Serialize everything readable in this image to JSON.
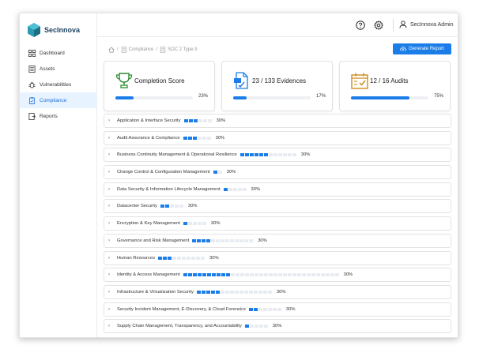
{
  "brand": {
    "name": "SecInnova",
    "color": "#2a9ab1"
  },
  "accent": "#1b7de8",
  "sidebar": {
    "items": [
      {
        "label": "Dashboard",
        "icon": "grid-icon",
        "active": false
      },
      {
        "label": "Assets",
        "icon": "list-icon",
        "active": false
      },
      {
        "label": "Vulnerabilities",
        "icon": "bug-icon",
        "active": false
      },
      {
        "label": "Compliance",
        "icon": "clipboard-icon",
        "active": true
      },
      {
        "label": "Reports",
        "icon": "report-icon",
        "active": false
      }
    ]
  },
  "topbar": {
    "user_name": "SecInnova Admin"
  },
  "breadcrumb": {
    "items": [
      "Compliance",
      "SOC 2 Type II"
    ]
  },
  "toolbar": {
    "generate_label": "Generate Report"
  },
  "cards": [
    {
      "title": "Completion Score",
      "percent_label": "23%",
      "progress": 0.23,
      "icon": "trophy-icon"
    },
    {
      "title": "23 / 133 Evidences",
      "percent_label": "17%",
      "progress": 0.17,
      "icon": "document-check-icon"
    },
    {
      "title": "12 / 16 Audits",
      "percent_label": "75%",
      "progress": 0.75,
      "icon": "calendar-check-icon"
    }
  ],
  "categories": [
    {
      "name": "Application & Interface Security",
      "percent_label": "30%",
      "filled": 3,
      "total": 6
    },
    {
      "name": "Audit Assurance & Compliance",
      "percent_label": "30%",
      "filled": 3,
      "total": 6
    },
    {
      "name": "Business Continuity Management & Operational Resilience",
      "percent_label": "30%",
      "filled": 6,
      "total": 12
    },
    {
      "name": "Change Control & Configuration Management",
      "percent_label": "30%",
      "filled": 1,
      "total": 2
    },
    {
      "name": "Data Security & Information Lifecycle Management",
      "percent_label": "30%",
      "filled": 1,
      "total": 5
    },
    {
      "name": "Datacenter Security",
      "percent_label": "30%",
      "filled": 2,
      "total": 5
    },
    {
      "name": "Encryption & Key Management",
      "percent_label": "30%",
      "filled": 1,
      "total": 5
    },
    {
      "name": "Governance and Risk Management",
      "percent_label": "30%",
      "filled": 4,
      "total": 13
    },
    {
      "name": "Human Resources",
      "percent_label": "30%",
      "filled": 3,
      "total": 10
    },
    {
      "name": "Identity & Access Management",
      "percent_label": "30%",
      "filled": 10,
      "total": 33
    },
    {
      "name": "Infrastructure & Virtualization Security",
      "percent_label": "30%",
      "filled": 5,
      "total": 16
    },
    {
      "name": "Security Incident Management, E-Discovery, & Cloud Forensics",
      "percent_label": "30%",
      "filled": 2,
      "total": 7
    },
    {
      "name": "Supply Chain Management, Transparency, and Accountability",
      "percent_label": "30%",
      "filled": 1,
      "total": 5
    }
  ]
}
